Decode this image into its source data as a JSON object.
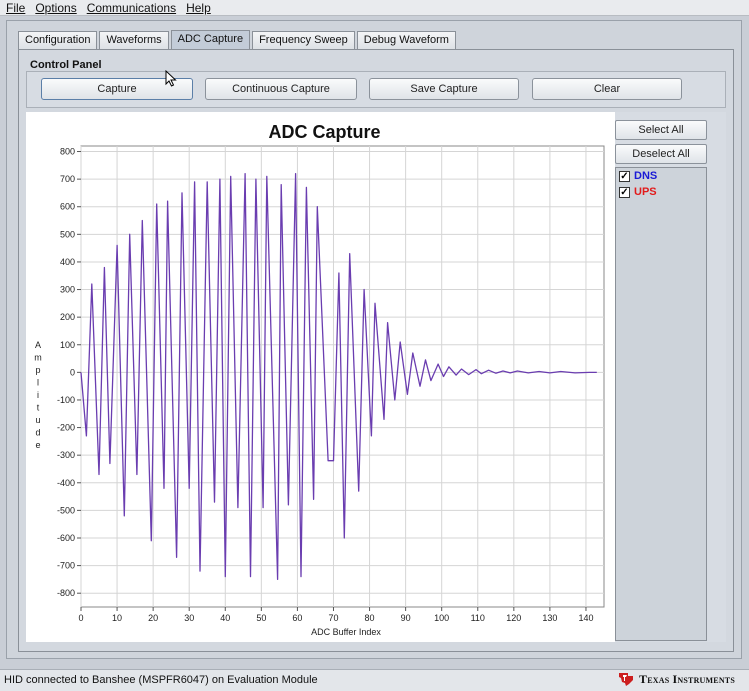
{
  "menu": [
    "File",
    "Options",
    "Communications",
    "Help"
  ],
  "tabs": [
    "Configuration",
    "Waveforms",
    "ADC Capture",
    "Frequency Sweep",
    "Debug Waveform"
  ],
  "active_tab": "ADC Capture",
  "control_panel": {
    "label": "Control Panel",
    "buttons": [
      "Capture",
      "Continuous Capture",
      "Save Capture",
      "Clear"
    ]
  },
  "side_panel": {
    "select_all": "Select All",
    "deselect_all": "Deselect All",
    "series": [
      {
        "name": "DNS",
        "checked": true,
        "color": "#1a1ad6"
      },
      {
        "name": "UPS",
        "checked": true,
        "color": "#e21b1b"
      }
    ]
  },
  "status_text": "HID connected to Banshee (MSPFR6047) on Evaluation Module",
  "logo_text": "Texas Instruments",
  "colors": {
    "line": "#6a3db0",
    "grid": "#d5d5d5"
  },
  "chart_data": {
    "type": "line",
    "title": "ADC Capture",
    "xlabel": "ADC Buffer Index",
    "ylabel": "Amplitude",
    "xlim": [
      0,
      145
    ],
    "ylim": [
      -850,
      820
    ],
    "xticks": [
      0,
      10,
      20,
      30,
      40,
      50,
      60,
      70,
      80,
      90,
      100,
      110,
      120,
      130,
      140
    ],
    "yticks": [
      800,
      700,
      600,
      500,
      400,
      300,
      200,
      100,
      0,
      -100,
      -200,
      -300,
      -400,
      -500,
      -600,
      -700,
      -800
    ],
    "grid": true,
    "series": [
      {
        "name": "DNS",
        "points": [
          [
            0,
            0
          ],
          [
            1.5,
            -230
          ],
          [
            3,
            320
          ],
          [
            5,
            -370
          ],
          [
            6.5,
            380
          ],
          [
            8,
            -330
          ],
          [
            10,
            460
          ],
          [
            12,
            -520
          ],
          [
            13.5,
            500
          ],
          [
            15.5,
            -370
          ],
          [
            17,
            550
          ],
          [
            19.5,
            -610
          ],
          [
            21,
            610
          ],
          [
            23,
            -420
          ],
          [
            24,
            620
          ],
          [
            26.5,
            -670
          ],
          [
            28,
            650
          ],
          [
            30,
            -420
          ],
          [
            31.5,
            690
          ],
          [
            33,
            -720
          ],
          [
            35,
            690
          ],
          [
            37,
            -470
          ],
          [
            38.5,
            700
          ],
          [
            40,
            -740
          ],
          [
            41.5,
            710
          ],
          [
            43.5,
            -490
          ],
          [
            45.5,
            720
          ],
          [
            47,
            -740
          ],
          [
            48.5,
            700
          ],
          [
            50.5,
            -490
          ],
          [
            51.5,
            710
          ],
          [
            54.5,
            -750
          ],
          [
            55.5,
            680
          ],
          [
            57.5,
            -480
          ],
          [
            59.5,
            720
          ],
          [
            61,
            -740
          ],
          [
            62.5,
            670
          ],
          [
            64.5,
            -460
          ],
          [
            65.5,
            600
          ],
          [
            68.5,
            -320
          ],
          [
            70,
            -320
          ],
          [
            71.5,
            360
          ],
          [
            73,
            -600
          ],
          [
            74.5,
            430
          ],
          [
            77,
            -430
          ],
          [
            78.5,
            300
          ],
          [
            80.5,
            -230
          ],
          [
            81.5,
            250
          ],
          [
            84,
            -170
          ],
          [
            85,
            180
          ],
          [
            87,
            -100
          ],
          [
            88.5,
            110
          ],
          [
            90.5,
            -80
          ],
          [
            92,
            70
          ],
          [
            94,
            -50
          ],
          [
            95.5,
            45
          ],
          [
            97,
            -30
          ],
          [
            99,
            30
          ],
          [
            100.5,
            -15
          ],
          [
            102,
            20
          ],
          [
            104,
            -10
          ],
          [
            105.5,
            12
          ],
          [
            107.5,
            -8
          ],
          [
            109.5,
            10
          ],
          [
            111,
            -5
          ],
          [
            113,
            8
          ],
          [
            115,
            -3
          ],
          [
            117,
            5
          ],
          [
            119,
            -2
          ],
          [
            121,
            5
          ],
          [
            124,
            -2
          ],
          [
            127,
            3
          ],
          [
            130,
            -2
          ],
          [
            133,
            3
          ],
          [
            137,
            -2
          ],
          [
            141,
            0
          ],
          [
            143,
            0
          ]
        ]
      }
    ]
  }
}
